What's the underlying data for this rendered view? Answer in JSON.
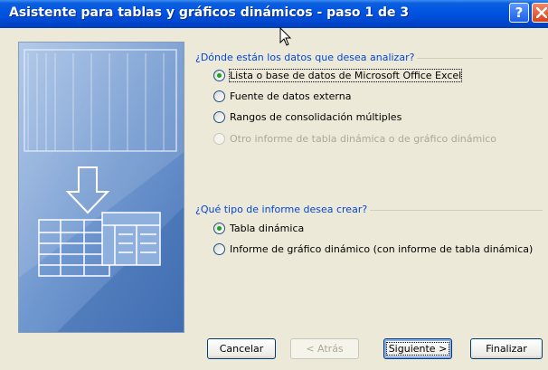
{
  "window": {
    "title": "Asistente para tablas y gráficos dinámicos - paso 1 de 3",
    "help_label": "?"
  },
  "data_source_group": {
    "label": "¿Dónde están los datos que desea analizar?",
    "options": [
      {
        "label": "Lista o base de datos de Microsoft Office Excel",
        "checked": true,
        "disabled": false
      },
      {
        "label": "Fuente de datos externa",
        "checked": false,
        "disabled": false
      },
      {
        "label": "Rangos de consolidación múltiples",
        "checked": false,
        "disabled": false
      },
      {
        "label": "Otro informe de tabla dinámica o de gráfico dinámico",
        "checked": false,
        "disabled": true
      }
    ]
  },
  "report_type_group": {
    "label": "¿Qué tipo de informe desea crear?",
    "options": [
      {
        "label": "Tabla dinámica",
        "checked": true,
        "disabled": false
      },
      {
        "label": "Informe de gráfico dinámico (con informe de tabla dinámica)",
        "checked": false,
        "disabled": false
      }
    ]
  },
  "buttons": {
    "cancel": "Cancelar",
    "back": "< Atrás",
    "next": "Siguiente >",
    "finish": "Finalizar"
  },
  "colors": {
    "titlebar": "#0054e3",
    "group_label": "#0046d5",
    "radio_checked": "#21a121"
  }
}
